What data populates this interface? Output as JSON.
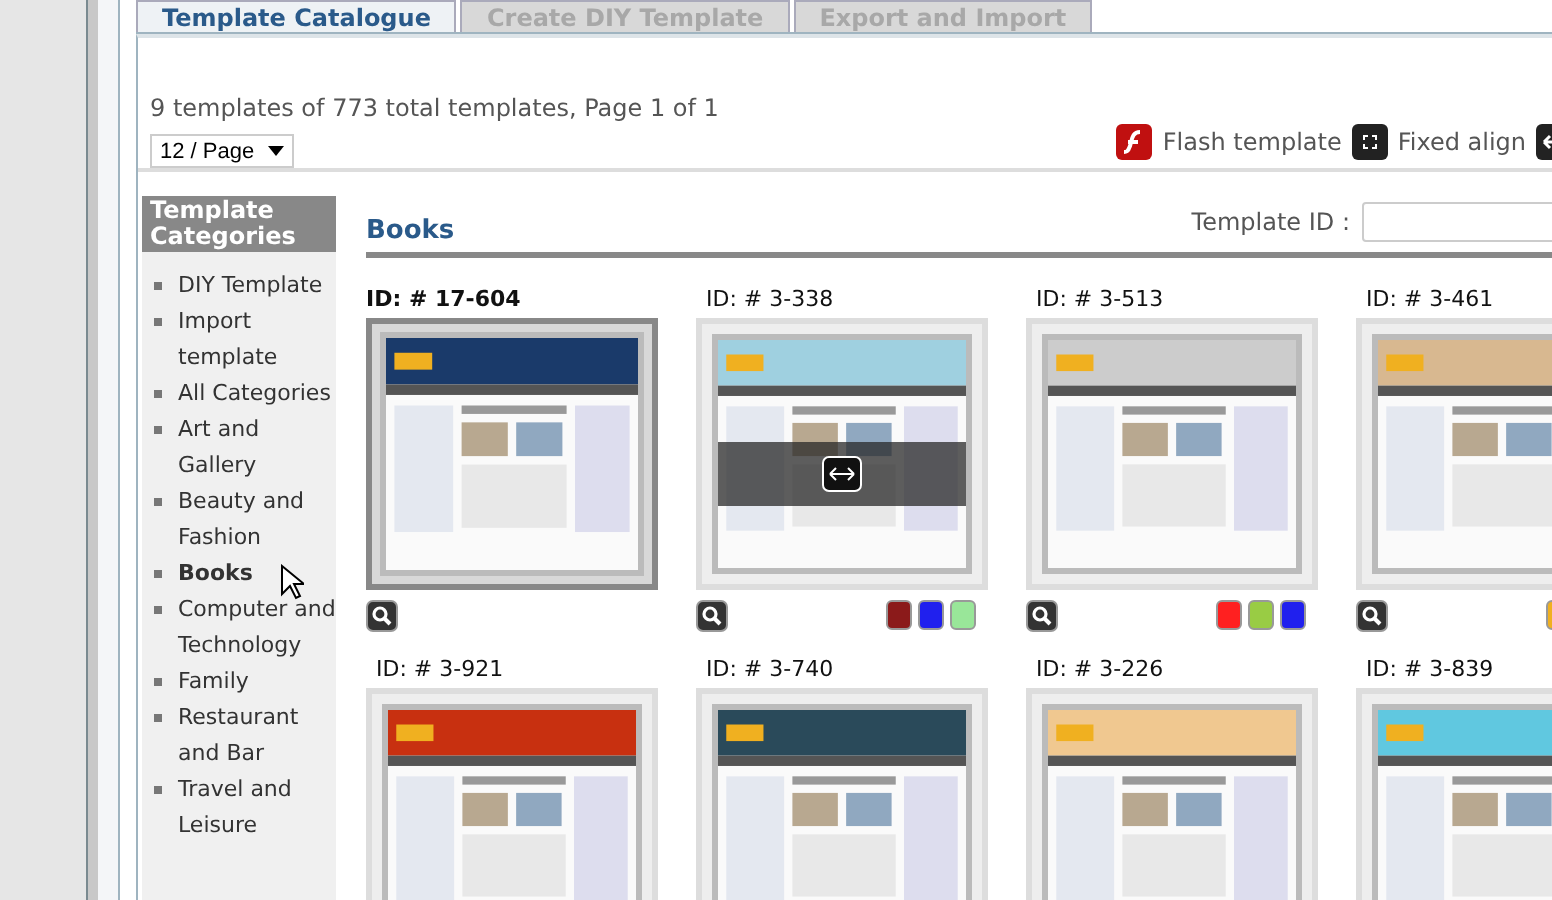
{
  "tabs": [
    {
      "label": "Template Catalogue",
      "selected": true
    },
    {
      "label": "Create DIY Template",
      "selected": false
    },
    {
      "label": "Export and Import",
      "selected": false
    }
  ],
  "summary": "9 templates of 773 total templates, Page 1 of 1",
  "per_page": {
    "value": "12 / Page"
  },
  "toolbar": [
    {
      "kind": "flash",
      "label": "Flash template"
    },
    {
      "kind": "fixed",
      "label": "Fixed align"
    },
    {
      "kind": "arrow"
    }
  ],
  "sidebar": {
    "title": "Template Categories",
    "items": [
      {
        "label": "DIY Template",
        "selected": false
      },
      {
        "label": "Import template",
        "selected": false
      },
      {
        "label": "All Categories",
        "selected": false
      },
      {
        "label": "Art and Gallery",
        "selected": false
      },
      {
        "label": "Beauty and Fashion",
        "selected": false
      },
      {
        "label": "Books",
        "selected": true
      },
      {
        "label": "Computer and Technology",
        "selected": false
      },
      {
        "label": "Family",
        "selected": false
      },
      {
        "label": "Restaurant and Bar",
        "selected": false
      },
      {
        "label": "Travel and Leisure",
        "selected": false
      }
    ]
  },
  "section_title": "Books",
  "search": {
    "label": "Template ID :"
  },
  "templates": [
    {
      "id": "ID: # 17-604",
      "selected": true,
      "hovered": false
    },
    {
      "id": "ID: # 3-338",
      "selected": false,
      "hovered": true,
      "swatches": [
        {
          "color": "#8b1a1a"
        },
        {
          "color": "#2020ee"
        },
        {
          "color": "#99e699"
        }
      ]
    },
    {
      "id": "ID: # 3-513",
      "selected": false,
      "hovered": false,
      "swatches": [
        {
          "color": "#ff2020"
        },
        {
          "color": "#99cc44"
        },
        {
          "color": "#2020ee"
        }
      ]
    },
    {
      "id": "ID: # 3-461",
      "selected": false,
      "hovered": false,
      "swatches": [
        {
          "color": "#f0b020"
        }
      ]
    },
    {
      "id": "ID: # 3-921",
      "selected": false,
      "hovered": false
    },
    {
      "id": "ID: # 3-740",
      "selected": false,
      "hovered": false
    },
    {
      "id": "ID: # 3-226",
      "selected": false,
      "hovered": false
    },
    {
      "id": "ID: # 3-839",
      "selected": false,
      "hovered": false
    }
  ]
}
